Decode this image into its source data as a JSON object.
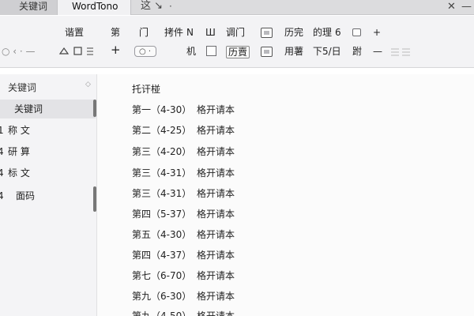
{
  "tabs": {
    "tab1": "关键词",
    "tab2": "WordTono",
    "tab3": "这 ↘",
    "tab4": "·",
    "close": "✕",
    "minimize": "—"
  },
  "ribbon": {
    "r1": [
      "谐置",
      "第",
      "门",
      "拷件",
      "N",
      "Ш",
      "调门",
      "历完",
      "的理",
      "6",
      "+"
    ],
    "r2_left": "○ ‹ · —",
    "r2_pill": "○ ·",
    "r2": [
      "机",
      "历賣",
      "用薯",
      "下5/日",
      "跗",
      "—"
    ]
  },
  "sidebar": {
    "header": "关键词",
    "items": [
      {
        "prefix": "",
        "label": "关键词"
      },
      {
        "prefix": "1",
        "label": "称 文"
      },
      {
        "prefix": "4",
        "label": "研 算"
      },
      {
        "prefix": "4",
        "label": "标 文"
      },
      {
        "prefix": "4",
        "label": "面码"
      }
    ]
  },
  "main": {
    "title": "托讦椪",
    "rows": [
      {
        "code": "第一（4-30）",
        "text": "格开请本"
      },
      {
        "code": "第二（4-25）",
        "text": "格开请本"
      },
      {
        "code": "第三（4-20）",
        "text": "格开请本"
      },
      {
        "code": "第三（4-31）",
        "text": "格开请本"
      },
      {
        "code": "第三（4-31）",
        "text": "格开请本"
      },
      {
        "code": "第四（5-37）",
        "text": "格开请本"
      },
      {
        "code": "第五（4-30）",
        "text": "格开请本"
      },
      {
        "code": "第四（4-37）",
        "text": "格开请本"
      },
      {
        "code": "第七（6-70）",
        "text": "格开请本"
      },
      {
        "code": "第九（6-30）",
        "text": "格开请本"
      },
      {
        "code": "第九（4-50）",
        "text": "格开请本"
      }
    ]
  }
}
